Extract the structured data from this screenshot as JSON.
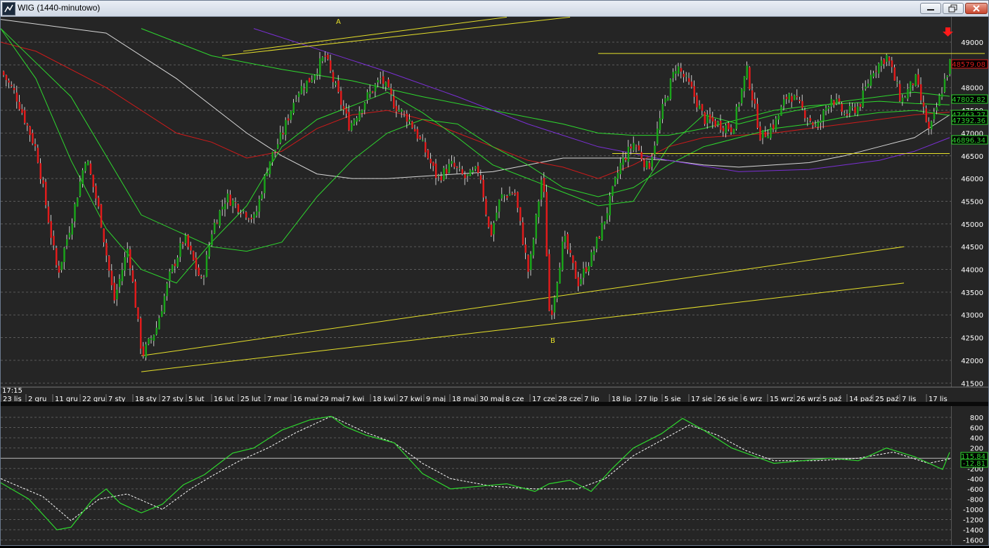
{
  "window": {
    "title": "WIG (1440-minutowo)",
    "buttons": [
      "minimize",
      "restore",
      "close"
    ]
  },
  "colors": {
    "background": "#252525",
    "grid": "#5a5a5a",
    "bull_candle": "#1aa31a",
    "bear_candle": "#e01b1b",
    "trendline": "#e8e22a",
    "ma_white": "#d8d8d8",
    "ma_red": "#d01a1a",
    "ma_green": "#2ed82e",
    "ma_purple": "#7b2fd6",
    "oscillator": "#2ed82e",
    "signal": "#ffffff"
  },
  "price_chart": {
    "time_label": "17:15",
    "annotation_a": "A",
    "annotation_b": "B",
    "y_ticks": [
      "49000",
      "48500",
      "48000",
      "47500",
      "47000",
      "46500",
      "46000",
      "45500",
      "45000",
      "44500",
      "44000",
      "43500",
      "43000",
      "42500",
      "42000",
      "41500"
    ],
    "x_ticks": [
      "23 lis",
      "2 gru",
      "11 gru",
      "22 gru",
      "7 sty",
      "18 sty",
      "27 sty",
      "5 lut",
      "16 lut",
      "25 lut",
      "7 mar",
      "16 mar",
      "29 mar",
      "7 kwi",
      "18 kwi",
      "27 kwi",
      "9 maj",
      "18 maj",
      "30 maj",
      "8 cze",
      "17 cze",
      "28 cze",
      "7 lip",
      "18 lip",
      "27 lip",
      "5 sie",
      "17 sie",
      "26 sie",
      "6 wrz",
      "15 wrz",
      "26 wrz",
      "5 paź",
      "14 paź",
      "25 paź",
      "7 lis",
      "17 lis"
    ],
    "value_labels": [
      {
        "text": "48579.08",
        "color": "#e01b1b"
      },
      {
        "text": "47802.82",
        "color": "#2ed82e"
      },
      {
        "text": "47463.27",
        "color": "#2ed82e"
      },
      {
        "text": "47392.36",
        "color": "#2ed82e"
      },
      {
        "text": "46896.34",
        "color": "#2ed82e"
      }
    ]
  },
  "oscillator": {
    "y_ticks": [
      "800",
      "600",
      "400",
      "200",
      "-200",
      "-400",
      "-600",
      "-800",
      "-1000",
      "-1200",
      "-1400",
      "-1600"
    ],
    "value_labels": [
      {
        "text": "115.84",
        "color": "#2ed82e"
      },
      {
        "text": "-12.81",
        "color": "#2ed82e"
      }
    ]
  },
  "chart_data": {
    "type": "candlestick",
    "title": "WIG (1440-minutowo)",
    "y_range": [
      41500,
      49300
    ],
    "close_anchors": [
      [
        0,
        48350
      ],
      [
        20,
        47850
      ],
      [
        50,
        46600
      ],
      [
        80,
        43900
      ],
      [
        100,
        45100
      ],
      [
        120,
        46500
      ],
      [
        140,
        45200
      ],
      [
        160,
        43300
      ],
      [
        180,
        44500
      ],
      [
        200,
        42100
      ],
      [
        220,
        42700
      ],
      [
        240,
        43900
      ],
      [
        260,
        44700
      ],
      [
        285,
        43700
      ],
      [
        300,
        44900
      ],
      [
        320,
        45600
      ],
      [
        340,
        45350
      ],
      [
        360,
        45100
      ],
      [
        380,
        46350
      ],
      [
        400,
        47000
      ],
      [
        420,
        47900
      ],
      [
        440,
        48200
      ],
      [
        460,
        48700
      ],
      [
        475,
        48000
      ],
      [
        495,
        47150
      ],
      [
        520,
        47800
      ],
      [
        540,
        48200
      ],
      [
        560,
        47600
      ],
      [
        580,
        47300
      ],
      [
        600,
        46700
      ],
      [
        620,
        46000
      ],
      [
        640,
        46300
      ],
      [
        660,
        46000
      ],
      [
        680,
        46200
      ],
      [
        695,
        44700
      ],
      [
        710,
        45600
      ],
      [
        730,
        45700
      ],
      [
        750,
        43900
      ],
      [
        770,
        46200
      ],
      [
        780,
        42850
      ],
      [
        800,
        44700
      ],
      [
        820,
        43700
      ],
      [
        840,
        44300
      ],
      [
        860,
        45200
      ],
      [
        880,
        46300
      ],
      [
        900,
        46800
      ],
      [
        920,
        46200
      ],
      [
        940,
        47500
      ],
      [
        960,
        48500
      ],
      [
        980,
        48000
      ],
      [
        1000,
        47300
      ],
      [
        1020,
        47200
      ],
      [
        1040,
        47100
      ],
      [
        1060,
        48400
      ],
      [
        1080,
        46900
      ],
      [
        1100,
        47200
      ],
      [
        1120,
        47900
      ],
      [
        1140,
        47500
      ],
      [
        1160,
        47100
      ],
      [
        1180,
        47800
      ],
      [
        1200,
        47400
      ],
      [
        1220,
        47600
      ],
      [
        1240,
        48400
      ],
      [
        1260,
        48700
      ],
      [
        1280,
        47700
      ],
      [
        1300,
        48200
      ],
      [
        1320,
        47000
      ],
      [
        1335,
        47800
      ],
      [
        1350,
        48580
      ]
    ],
    "moving_averages": {
      "white": [
        [
          0,
          49500
        ],
        [
          150,
          49200
        ],
        [
          250,
          48200
        ],
        [
          350,
          47000
        ],
        [
          400,
          46500
        ],
        [
          450,
          46100
        ],
        [
          500,
          46000
        ],
        [
          550,
          46000
        ],
        [
          600,
          46050
        ],
        [
          650,
          46100
        ],
        [
          700,
          46150
        ],
        [
          750,
          46300
        ],
        [
          800,
          46450
        ],
        [
          850,
          46450
        ],
        [
          900,
          46450
        ],
        [
          950,
          46400
        ],
        [
          1000,
          46300
        ],
        [
          1050,
          46250
        ],
        [
          1100,
          46300
        ],
        [
          1150,
          46350
        ],
        [
          1200,
          46500
        ],
        [
          1250,
          46700
        ],
        [
          1300,
          46900
        ],
        [
          1350,
          47400
        ]
      ],
      "red": [
        [
          0,
          49000
        ],
        [
          50,
          48800
        ],
        [
          150,
          48000
        ],
        [
          250,
          47000
        ],
        [
          300,
          46800
        ],
        [
          350,
          46450
        ],
        [
          400,
          46600
        ],
        [
          450,
          47100
        ],
        [
          500,
          47400
        ],
        [
          550,
          47500
        ],
        [
          600,
          47300
        ],
        [
          650,
          47000
        ],
        [
          700,
          46700
        ],
        [
          750,
          46400
        ],
        [
          800,
          46250
        ],
        [
          850,
          46000
        ],
        [
          900,
          46300
        ],
        [
          950,
          46700
        ],
        [
          1000,
          46900
        ],
        [
          1050,
          46950
        ],
        [
          1100,
          47000
        ],
        [
          1150,
          47100
        ],
        [
          1200,
          47200
        ],
        [
          1250,
          47300
        ],
        [
          1300,
          47400
        ],
        [
          1350,
          47460
        ]
      ],
      "green_fast": [
        [
          0,
          49300
        ],
        [
          50,
          48200
        ],
        [
          100,
          46400
        ],
        [
          150,
          44900
        ],
        [
          200,
          44000
        ],
        [
          250,
          43700
        ],
        [
          300,
          44600
        ],
        [
          350,
          45400
        ],
        [
          400,
          46700
        ],
        [
          450,
          47300
        ],
        [
          500,
          47600
        ],
        [
          550,
          47900
        ],
        [
          600,
          47450
        ],
        [
          650,
          46900
        ],
        [
          700,
          46300
        ],
        [
          750,
          46000
        ],
        [
          800,
          45700
        ],
        [
          850,
          45400
        ],
        [
          900,
          45500
        ],
        [
          950,
          46700
        ],
        [
          1000,
          47400
        ],
        [
          1050,
          47200
        ],
        [
          1100,
          47400
        ],
        [
          1150,
          47550
        ],
        [
          1200,
          47700
        ],
        [
          1250,
          47800
        ],
        [
          1300,
          47900
        ],
        [
          1350,
          47810
        ]
      ],
      "green_mid": [
        [
          0,
          49300
        ],
        [
          100,
          47800
        ],
        [
          200,
          45200
        ],
        [
          300,
          44500
        ],
        [
          350,
          44400
        ],
        [
          400,
          44600
        ],
        [
          450,
          45600
        ],
        [
          500,
          46400
        ],
        [
          550,
          47000
        ],
        [
          600,
          47300
        ],
        [
          650,
          47200
        ],
        [
          700,
          46700
        ],
        [
          750,
          46300
        ],
        [
          800,
          45800
        ],
        [
          850,
          45600
        ],
        [
          900,
          45800
        ],
        [
          950,
          46300
        ],
        [
          1000,
          46700
        ],
        [
          1050,
          46900
        ],
        [
          1100,
          47100
        ],
        [
          1150,
          47200
        ],
        [
          1200,
          47350
        ],
        [
          1250,
          47450
        ],
        [
          1300,
          47500
        ],
        [
          1350,
          47390
        ]
      ],
      "green_slow": [
        [
          200,
          49300
        ],
        [
          300,
          48700
        ],
        [
          400,
          48400
        ],
        [
          500,
          48150
        ],
        [
          600,
          47800
        ],
        [
          700,
          47500
        ],
        [
          800,
          47200
        ],
        [
          850,
          47000
        ],
        [
          900,
          46950
        ],
        [
          950,
          46950
        ],
        [
          1000,
          47100
        ],
        [
          1050,
          47300
        ],
        [
          1100,
          47500
        ],
        [
          1150,
          47600
        ],
        [
          1200,
          47650
        ],
        [
          1250,
          47700
        ],
        [
          1300,
          47650
        ],
        [
          1350,
          47620
        ]
      ],
      "purple": [
        [
          360,
          49300
        ],
        [
          450,
          48850
        ],
        [
          550,
          48350
        ],
        [
          650,
          47800
        ],
        [
          750,
          47200
        ],
        [
          850,
          46700
        ],
        [
          950,
          46400
        ],
        [
          1050,
          46150
        ],
        [
          1150,
          46200
        ],
        [
          1250,
          46400
        ],
        [
          1300,
          46600
        ],
        [
          1350,
          46900
        ]
      ]
    },
    "trendlines": [
      {
        "from": [
          200,
          42100
        ],
        "to": [
          1285,
          44500
        ]
      },
      {
        "from": [
          200,
          41750
        ],
        "to": [
          1285,
          43700
        ]
      },
      {
        "from": [
          315,
          48700
        ],
        "to": [
          810,
          49550
        ]
      },
      {
        "from": [
          345,
          48800
        ],
        "to": [
          720,
          49550
        ]
      },
      {
        "from": [
          850,
          48750
        ],
        "to": [
          1400,
          48750
        ]
      },
      {
        "from": [
          870,
          46550
        ],
        "to": [
          1350,
          46550
        ]
      }
    ],
    "oscillator": {
      "y_range": [
        -1650,
        900
      ],
      "line": [
        [
          0,
          -480
        ],
        [
          40,
          -800
        ],
        [
          80,
          -1400
        ],
        [
          100,
          -1350
        ],
        [
          130,
          -820
        ],
        [
          150,
          -600
        ],
        [
          170,
          -880
        ],
        [
          200,
          -1070
        ],
        [
          230,
          -900
        ],
        [
          260,
          -520
        ],
        [
          290,
          -320
        ],
        [
          330,
          100
        ],
        [
          360,
          200
        ],
        [
          400,
          550
        ],
        [
          440,
          750
        ],
        [
          470,
          820
        ],
        [
          490,
          620
        ],
        [
          520,
          450
        ],
        [
          560,
          300
        ],
        [
          600,
          -300
        ],
        [
          640,
          -600
        ],
        [
          680,
          -550
        ],
        [
          720,
          -500
        ],
        [
          760,
          -650
        ],
        [
          780,
          -500
        ],
        [
          810,
          -430
        ],
        [
          840,
          -650
        ],
        [
          870,
          -200
        ],
        [
          900,
          200
        ],
        [
          940,
          480
        ],
        [
          970,
          780
        ],
        [
          1000,
          550
        ],
        [
          1040,
          200
        ],
        [
          1080,
          0
        ],
        [
          1100,
          -100
        ],
        [
          1140,
          -50
        ],
        [
          1180,
          0
        ],
        [
          1220,
          -50
        ],
        [
          1260,
          200
        ],
        [
          1300,
          30
        ],
        [
          1340,
          -220
        ],
        [
          1350,
          116
        ]
      ],
      "signal": [
        [
          0,
          -400
        ],
        [
          60,
          -750
        ],
        [
          100,
          -1220
        ],
        [
          140,
          -800
        ],
        [
          180,
          -700
        ],
        [
          230,
          -1000
        ],
        [
          270,
          -600
        ],
        [
          300,
          -350
        ],
        [
          340,
          -50
        ],
        [
          380,
          200
        ],
        [
          420,
          500
        ],
        [
          470,
          820
        ],
        [
          520,
          500
        ],
        [
          560,
          300
        ],
        [
          600,
          -100
        ],
        [
          640,
          -400
        ],
        [
          700,
          -550
        ],
        [
          760,
          -600
        ],
        [
          820,
          -600
        ],
        [
          860,
          -400
        ],
        [
          900,
          50
        ],
        [
          940,
          350
        ],
        [
          980,
          650
        ],
        [
          1020,
          450
        ],
        [
          1060,
          150
        ],
        [
          1100,
          -50
        ],
        [
          1160,
          -50
        ],
        [
          1220,
          0
        ],
        [
          1270,
          120
        ],
        [
          1320,
          -100
        ],
        [
          1350,
          -13
        ]
      ]
    }
  }
}
